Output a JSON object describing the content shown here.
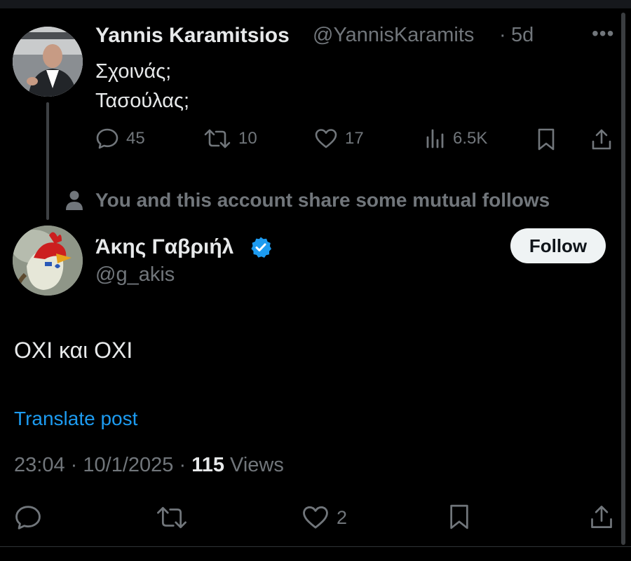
{
  "reply_to": {
    "display_name": "Yannis Karamitsios",
    "handle": "@YannisKaramits",
    "separator": "·",
    "age": "5d",
    "lines": [
      "Σχοινάς;",
      "Τασούλας;"
    ],
    "stats": {
      "replies": "45",
      "reposts": "10",
      "likes": "17",
      "views": "6.5K"
    }
  },
  "mutual_note": "You and this account share some mutual follows",
  "post": {
    "display_name": "Άκης Γαβριήλ",
    "handle": "@g_akis",
    "follow_label": "Follow",
    "text": "OXI και OXI",
    "translate_label": "Translate post",
    "time": "23:04",
    "date": "10/1/2025",
    "views_count": "115",
    "views_label": "Views",
    "meta_sep": "·",
    "likes": "2"
  },
  "colors": {
    "accent": "#1d9bf0",
    "muted": "#71767b",
    "text": "#e7e9ea",
    "background": "#000000"
  }
}
